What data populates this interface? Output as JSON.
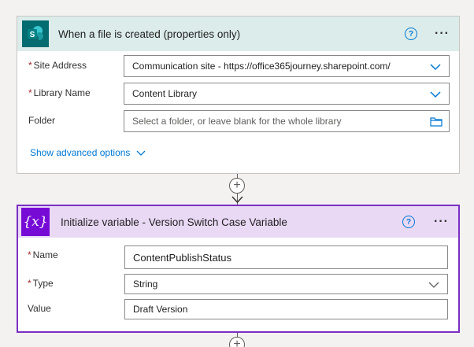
{
  "trigger": {
    "title": "When a file is created (properties only)",
    "fields": {
      "site_address": {
        "label": "Site Address",
        "required": true,
        "value": "Communication site - https://office365journey.sharepoint.com/"
      },
      "library_name": {
        "label": "Library Name",
        "required": true,
        "value": "Content Library"
      },
      "folder": {
        "label": "Folder",
        "required": false,
        "placeholder": "Select a folder, or leave blank for the whole library"
      }
    },
    "advanced_label": "Show advanced options",
    "accent_color": "#036c70"
  },
  "action": {
    "title": "Initialize variable - Version Switch Case Variable",
    "icon_text": "{x}",
    "fields": {
      "name": {
        "label": "Name",
        "required": true,
        "value": "ContentPublishStatus"
      },
      "type": {
        "label": "Type",
        "required": true,
        "value": "String"
      },
      "value": {
        "label": "Value",
        "required": false,
        "value": "Draft Version"
      }
    },
    "accent_color": "#770bd6"
  },
  "help_glyph": "?",
  "more_glyph": "···",
  "plus_glyph": "+",
  "required_marker": "*"
}
